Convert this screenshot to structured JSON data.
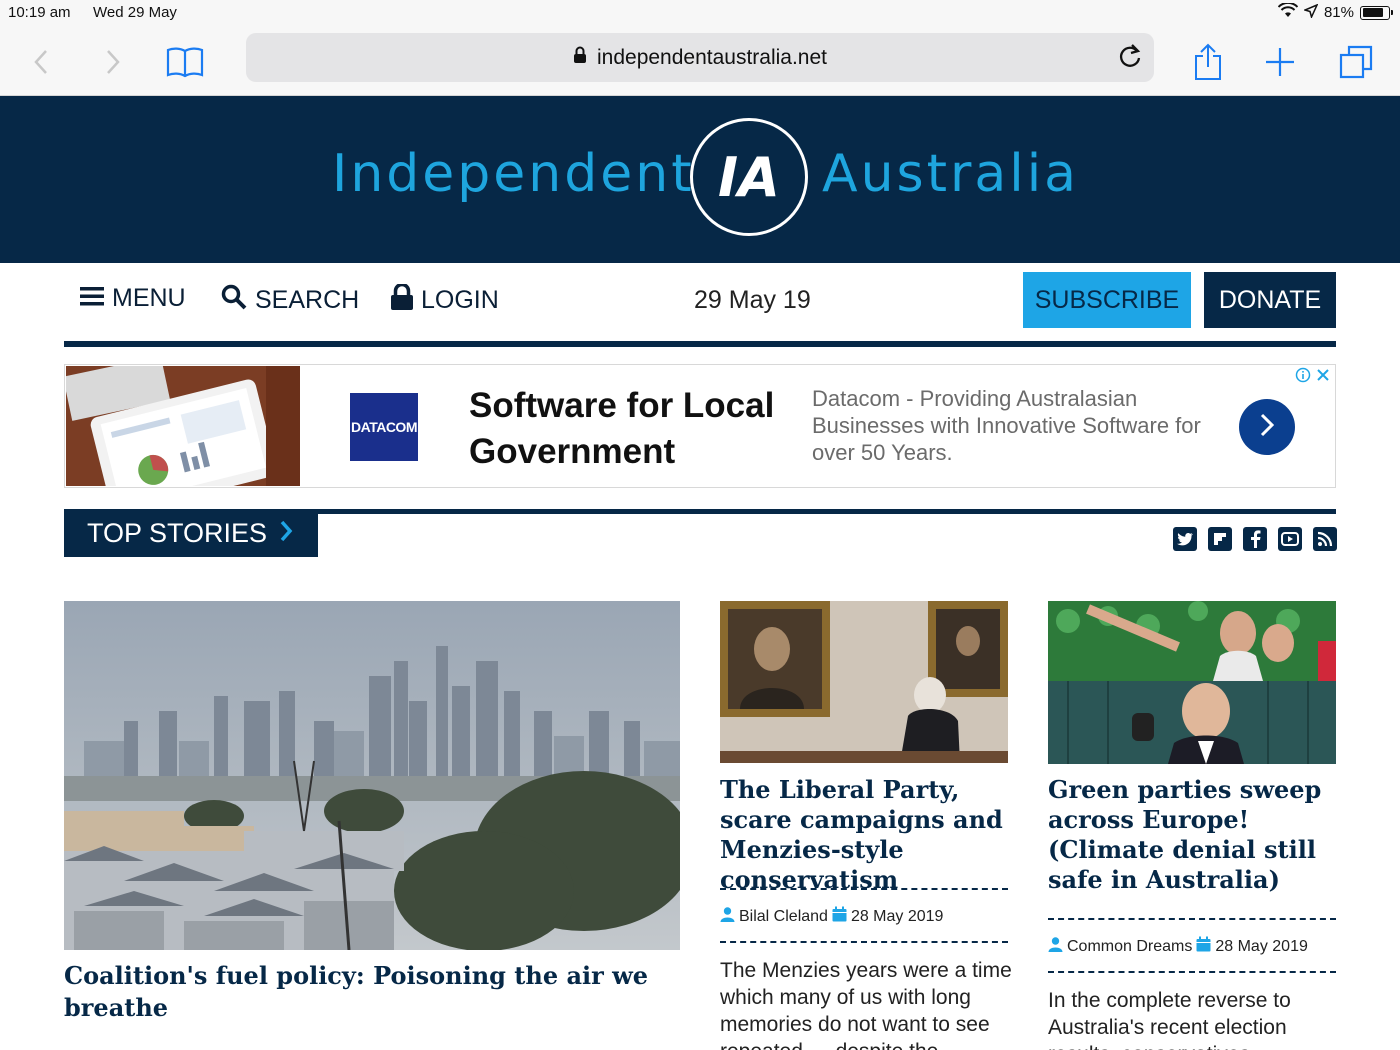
{
  "status_bar": {
    "time": "10:19 am",
    "date": "Wed 29 May",
    "battery": "81%",
    "battery_level": 0.81
  },
  "browser": {
    "url": "independentaustralia.net",
    "icons": [
      "back-icon",
      "forward-icon",
      "bookmarks-icon",
      "lock-icon",
      "reload-icon",
      "share-icon",
      "new-tab-icon",
      "tabs-icon"
    ]
  },
  "masthead": {
    "left_word": "Independent",
    "logo_mark": "IA",
    "right_word": "Australia",
    "colors": {
      "background": "#062847",
      "accent": "#1ea5de"
    }
  },
  "nav": {
    "menu": "MENU",
    "search": "SEARCH",
    "login": "LOGIN",
    "date": "29 May 19",
    "subscribe": "SUBSCRIBE",
    "donate": "DONATE"
  },
  "ad": {
    "brand": "DATACOM",
    "title": "Software for Local Government",
    "description": "Datacom - Providing Australasian Businesses with Innovative Software for over 50 Years."
  },
  "section": {
    "title": "TOP STORIES",
    "social_icons": [
      "twitter-icon",
      "flipboard-icon",
      "facebook-icon",
      "youtube-icon",
      "rss-icon"
    ]
  },
  "articles": [
    {
      "headline": "Coalition's fuel policy: Poisoning the air we breathe"
    },
    {
      "headline": "The Liberal Party, scare campaigns and Menzies-style conservatism",
      "author": "Bilal Cleland",
      "date": "28 May 2019",
      "excerpt": "The Menzies years were a time which many of us with long memories do not want to see repeated — despite the"
    },
    {
      "headline": "Green parties sweep across Europe! (Climate denial still safe in Australia)",
      "author": "Common Dreams",
      "date": "28 May 2019",
      "excerpt": "In the complete reverse to Australia's recent election results, conservatives"
    }
  ]
}
